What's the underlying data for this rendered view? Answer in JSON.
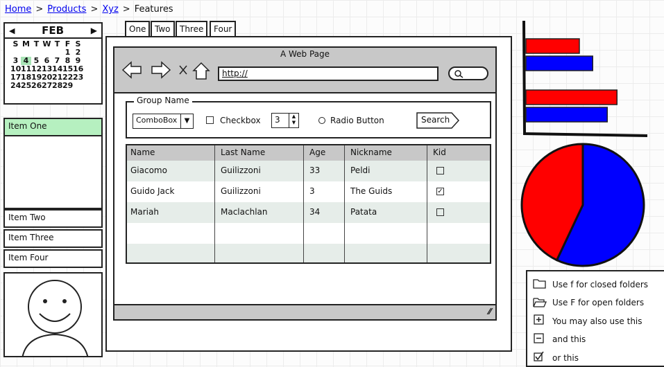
{
  "breadcrumb": {
    "items": [
      "Home",
      "Products",
      "Xyz"
    ],
    "current": "Features",
    "separator": ">"
  },
  "calendar": {
    "month": "FEB",
    "prev": "◀",
    "next": "▶",
    "weekdays": [
      "S",
      "M",
      "T",
      "W",
      "T",
      "F",
      "S"
    ],
    "days": [
      "",
      "",
      "",
      "",
      "",
      "1",
      "2",
      "3",
      "4",
      "5",
      "6",
      "7",
      "8",
      "9",
      "10",
      "11",
      "12",
      "13",
      "14",
      "15",
      "16",
      "17",
      "18",
      "19",
      "20",
      "21",
      "22",
      "23",
      "24",
      "25",
      "26",
      "27",
      "28",
      "29"
    ],
    "selected_day": "4",
    "highlight_color": "#a9e4b6"
  },
  "list": {
    "items": [
      "Item One",
      "Item Two",
      "Item Three",
      "Item Four"
    ],
    "selected": "Item One",
    "selected_color": "#b6f0c0"
  },
  "tabs": [
    "One",
    "Two",
    "Three",
    "Four"
  ],
  "browser": {
    "title": "A Web Page",
    "url": "http://",
    "icons": [
      "back-arrow",
      "forward-arrow",
      "close-x",
      "home",
      "search"
    ],
    "close_glyph": "×"
  },
  "group": {
    "label": "Group Name",
    "combo": "ComboBox",
    "checkbox": "Checkbox",
    "stepper": "3",
    "radio": "Radio Button",
    "search": "Search"
  },
  "table": {
    "headers": [
      "Name",
      "Last Name",
      "Age",
      "Nickname",
      "Kid"
    ],
    "rows": [
      [
        "Giacomo",
        "Guilizzoni",
        "33",
        "Peldi",
        false
      ],
      [
        "Guido Jack",
        "Guilizzoni",
        "3",
        "The Guids",
        true
      ],
      [
        "Mariah",
        "Maclachlan",
        "34",
        "Patata",
        false
      ]
    ]
  },
  "bar_chart": {
    "type": "bar",
    "orientation": "horizontal",
    "series_colors": [
      "#ff0000",
      "#0000ff"
    ],
    "groups": [
      [
        0.44,
        0.55
      ],
      [
        0.75,
        0.67
      ]
    ]
  },
  "pie_chart": {
    "type": "pie",
    "slices": [
      {
        "color": "#0000ff",
        "value": 57
      },
      {
        "color": "#ff0000",
        "value": 43
      }
    ]
  },
  "tree": {
    "items": [
      {
        "icon": "folder-closed",
        "label": "Use f for closed folders"
      },
      {
        "icon": "folder-open",
        "label": "Use F for open folders"
      },
      {
        "icon": "plus-box",
        "label": "You may also use this"
      },
      {
        "icon": "minus-box",
        "label": "and this"
      },
      {
        "icon": "checkbox-checked",
        "label": "or this"
      }
    ]
  }
}
